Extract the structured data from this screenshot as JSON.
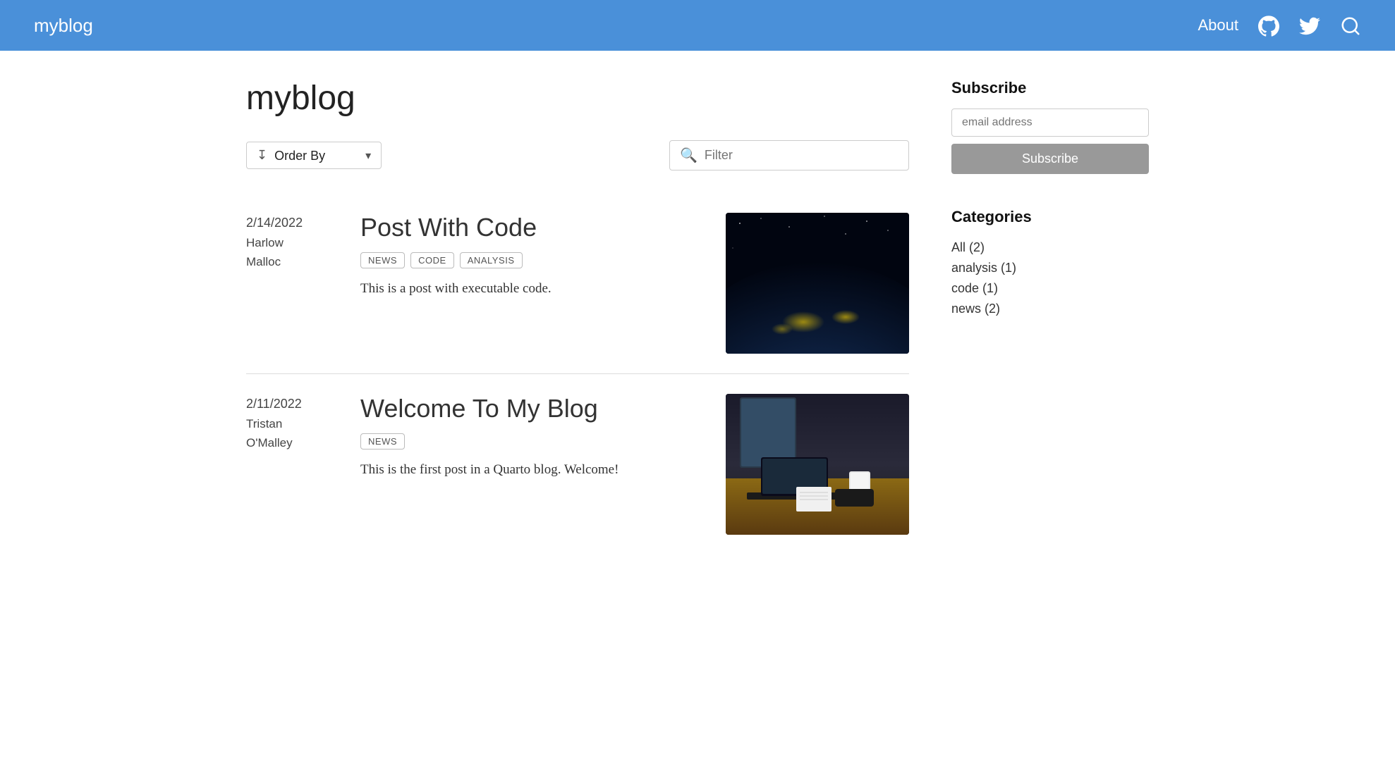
{
  "nav": {
    "brand": "myblog",
    "links": [
      {
        "label": "About",
        "href": "#"
      }
    ],
    "icons": {
      "github": "github-icon",
      "twitter": "twitter-icon",
      "search": "nav-search-icon"
    }
  },
  "main": {
    "title": "myblog",
    "toolbar": {
      "order_by_label": "Order By",
      "filter_placeholder": "Filter"
    },
    "posts": [
      {
        "date": "2/14/2022",
        "author_line1": "Harlow",
        "author_line2": "Malloc",
        "title": "Post With Code",
        "tags": [
          "NEWS",
          "CODE",
          "ANALYSIS"
        ],
        "excerpt": "This is a post with executable code.",
        "image_type": "earth"
      },
      {
        "date": "2/11/2022",
        "author_line1": "Tristan",
        "author_line2": "O'Malley",
        "title": "Welcome To My Blog",
        "tags": [
          "NEWS"
        ],
        "excerpt": "This is the first post in a Quarto blog. Welcome!",
        "image_type": "desk"
      }
    ]
  },
  "sidebar": {
    "subscribe": {
      "heading": "Subscribe",
      "email_placeholder": "email address",
      "button_label": "Subscribe"
    },
    "categories": {
      "heading": "Categories",
      "items": [
        {
          "label": "All (2)"
        },
        {
          "label": "analysis (1)"
        },
        {
          "label": "code (1)"
        },
        {
          "label": "news (2)"
        }
      ]
    }
  }
}
